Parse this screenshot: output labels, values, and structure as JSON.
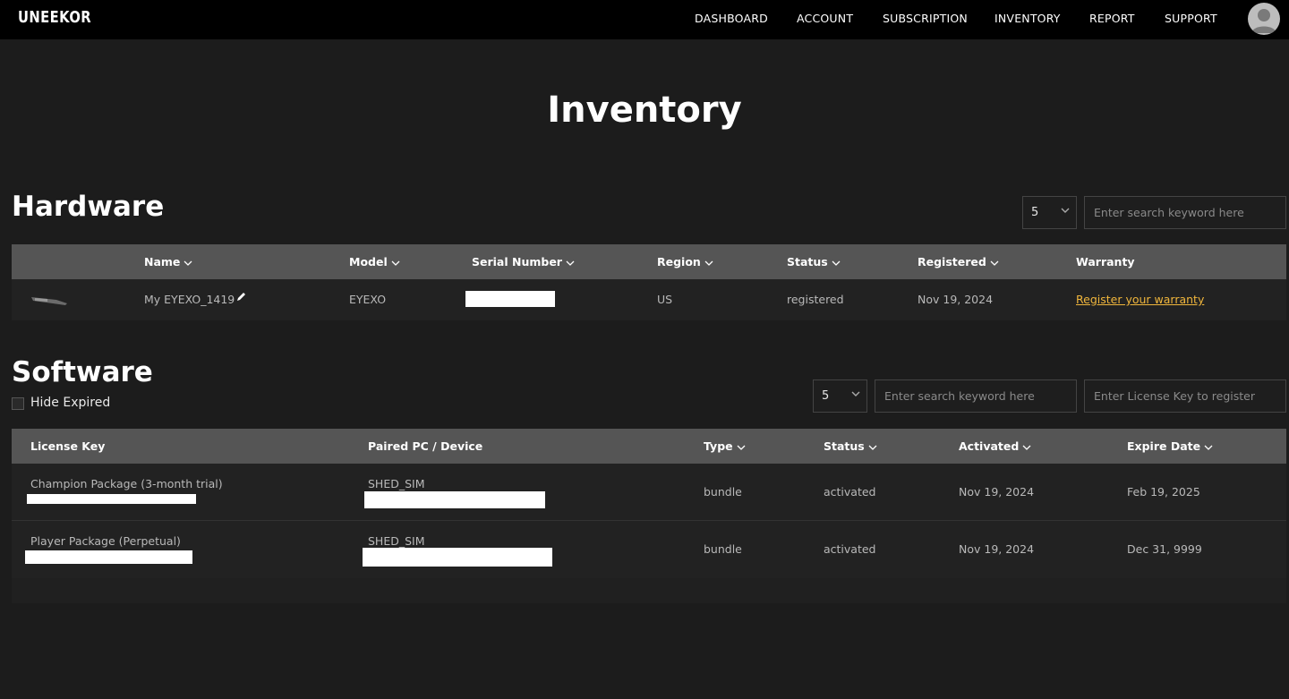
{
  "brand": {
    "logo": "UNEEKOR"
  },
  "nav": {
    "items": [
      "DASHBOARD",
      "ACCOUNT",
      "SUBSCRIPTION",
      "INVENTORY",
      "REPORT",
      "SUPPORT"
    ],
    "avatar_icon": "user-avatar-icon"
  },
  "page": {
    "title": "Inventory"
  },
  "hardware": {
    "title": "Hardware",
    "page_size": "5",
    "search_placeholder": "Enter search keyword here",
    "columns": [
      "Name",
      "Model",
      "Serial Number",
      "Region",
      "Status",
      "Registered",
      "Warranty"
    ],
    "rows": [
      {
        "thumbnail_icon": "device-thumbnail-icon",
        "name": "My EYEXO_1419",
        "edit_icon": "pencil-icon",
        "model": "EYEXO",
        "region": "US",
        "status": "registered",
        "registered": "Nov 19, 2024",
        "warranty": "Register your warranty"
      }
    ]
  },
  "software": {
    "title": "Software",
    "hide_expired_label": "Hide Expired",
    "page_size": "5",
    "search_placeholder": "Enter search keyword here",
    "license_placeholder": "Enter License Key to register",
    "columns": [
      "License Key",
      "Paired PC / Device",
      "Type",
      "Status",
      "Activated",
      "Expire Date"
    ],
    "rows": [
      {
        "license": "Champion Package (3-month trial)",
        "device": "SHED_SIM",
        "type": "bundle",
        "status": "activated",
        "activated": "Nov 19, 2024",
        "expire": "Feb 19, 2025"
      },
      {
        "license": "Player Package (Perpetual)",
        "device": "SHED_SIM",
        "type": "bundle",
        "status": "activated",
        "activated": "Nov 19, 2024",
        "expire": "Dec 31, 9999"
      }
    ]
  },
  "colors": {
    "accent_link": "#f0b63c",
    "header_bg": "#555555",
    "topbar_bg": "#000000"
  }
}
